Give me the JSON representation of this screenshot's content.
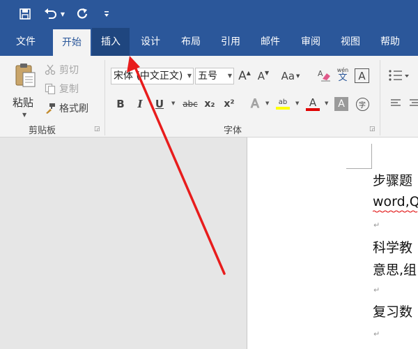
{
  "ribbon_tabs": [
    "文件",
    "开始",
    "插入",
    "设计",
    "布局",
    "引用",
    "邮件",
    "审阅",
    "视图",
    "帮助"
  ],
  "clipboard": {
    "paste_label": "粘贴",
    "cut_label": "剪切",
    "copy_label": "复制",
    "format_painter_label": "格式刷",
    "group_label": "剪贴板"
  },
  "font": {
    "font_name": "宋体 (中文正文)",
    "font_size": "五号",
    "group_label": "字体",
    "phonetic_top": "wén",
    "phonetic_bottom": "文",
    "border_char": "A",
    "grow_label": "A",
    "shrink_label": "A",
    "case_label": "Aa",
    "bold": "B",
    "italic": "I",
    "underline": "U",
    "strike": "abc",
    "sub": "x₂",
    "sup": "x²",
    "effects": "A",
    "highlight": "ab",
    "color_a": "A",
    "shade_a": "A",
    "circle_char": "字"
  },
  "document": {
    "lines": [
      "步骤题",
      "word,Q",
      "科学教",
      "意思,组",
      "复习数"
    ],
    "para_mark": "↵"
  },
  "colors": {
    "brand": "#2b579a",
    "highlight_yellow": "#ffff00",
    "font_color_red": "#e00000",
    "annotation_arrow": "#e81c1c"
  }
}
